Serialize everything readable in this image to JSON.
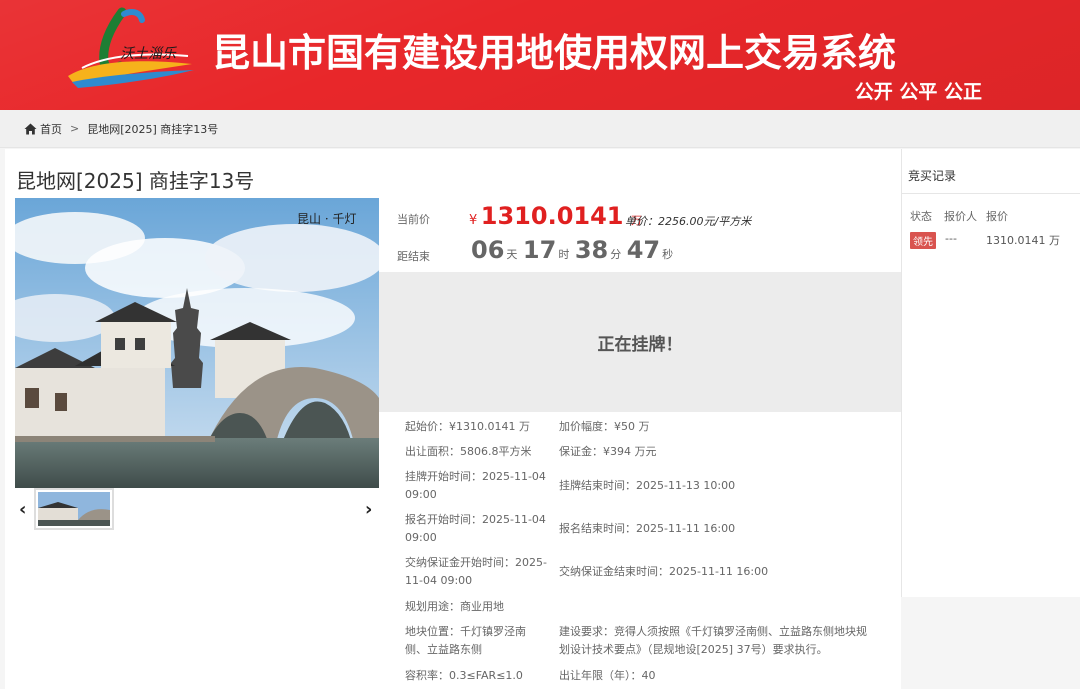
{
  "header": {
    "logo_text": "沃土淄乐",
    "title": "昆山市国有建设用地使用权网上交易系统",
    "slogan": "公开 公平 公正",
    "colors": {
      "banner": "#e8272a",
      "price": "#e02020",
      "badge": "#d9534f"
    }
  },
  "breadcrumb": {
    "home_icon": "home-icon",
    "home": "首页",
    "separator": ">",
    "current": "昆地网[2025] 商挂字13号"
  },
  "listing": {
    "title": "昆地网[2025] 商挂字13号",
    "photo_caption": "昆山 · 千灯",
    "gallery": {
      "prev_icon": "chevron-left-icon",
      "next_icon": "chevron-right-icon",
      "prev": "‹",
      "next": "›"
    }
  },
  "pricing": {
    "current_label": "当前价",
    "currency": "¥",
    "current_price": "1310.0141",
    "current_unit": "万",
    "unit_price": "单价：2256.00元/平方米",
    "countdown_label": "距结束",
    "countdown": {
      "days": "06",
      "days_unit": "天",
      "hours": "17",
      "hours_unit": "时",
      "minutes": "38",
      "minutes_unit": "分",
      "seconds": "47",
      "seconds_unit": "秒"
    }
  },
  "status": {
    "text": "正在挂牌！"
  },
  "details": [
    {
      "left": "起始价：¥1310.0141 万",
      "right": "加价幅度：¥50 万"
    },
    {
      "left": "出让面积：5806.8平方米",
      "right": "保证金：¥394 万元"
    },
    {
      "left": "挂牌开始时间：2025-11-04 09:00",
      "right": "挂牌结束时间：2025-11-13 10:00"
    },
    {
      "left": "报名开始时间：2025-11-04 09:00",
      "right": "报名结束时间：2025-11-11 16:00"
    },
    {
      "left": "交纳保证金开始时间：2025-11-04 09:00",
      "right": "交纳保证金结束时间：2025-11-11 16:00"
    },
    {
      "left": "规划用途：商业用地",
      "right": ""
    },
    {
      "left": "地块位置：千灯镇罗泾南侧、立益路东侧",
      "right": "建设要求：竞得人须按照《千灯镇罗泾南侧、立益路东侧地块规划设计技术要点》（昆规地设[2025] 37号）要求执行。"
    },
    {
      "left": "容积率：0.3≤FAR≤1.0",
      "right": "出让年限（年）：40"
    }
  ],
  "bid_record": {
    "title": "竞买记录",
    "headers": [
      "状态",
      "报价人",
      "报价"
    ],
    "rows": [
      {
        "status": "领先",
        "bidder": "---",
        "price": "1310.0141 万"
      }
    ]
  }
}
